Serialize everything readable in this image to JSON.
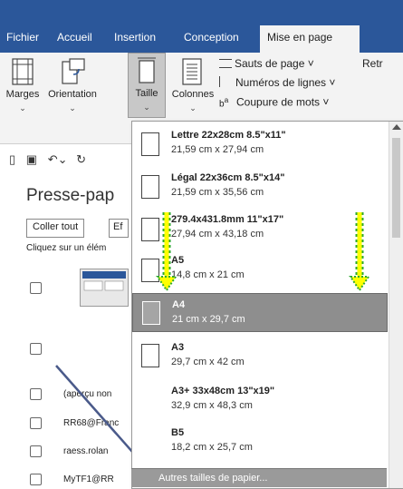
{
  "tabs": [
    "Fichier",
    "Accueil",
    "Insertion",
    "Conception",
    "Mise en page"
  ],
  "active_tab": "Mise en page",
  "ribbon": {
    "marges": "Marges",
    "orientation": "Orientation",
    "taille": "Taille",
    "colonnes": "Colonnes",
    "sauts": "Sauts de page ˅",
    "numeros": "Numéros de lignes ˅",
    "coupure": "Coupure de mots ˅",
    "retrait": "Retr"
  },
  "pane": {
    "title": "Presse-pap",
    "coller_tout": "Coller tout",
    "effacer_partial": "Ef",
    "hint": "Cliquez sur un élém",
    "clips": [
      "(aperçu non",
      "RR68@Franc",
      "raess.rolan",
      "MyTF1@RR"
    ]
  },
  "paper_sizes": [
    {
      "name": "Lettre 22x28cm 8.5\"x11\"",
      "dim": "21,59 cm x 27,94 cm"
    },
    {
      "name": "Légal 22x36cm 8.5\"x14\"",
      "dim": "21,59 cm x 35,56 cm"
    },
    {
      "name": "279.4x431.8mm 11\"x17\"",
      "dim": "27,94 cm x 43,18 cm"
    },
    {
      "name": "A5",
      "dim": "14,8 cm x 21 cm"
    },
    {
      "name": "A4",
      "dim": "21 cm x 29,7 cm"
    },
    {
      "name": "A3",
      "dim": "29,7 cm x 42 cm"
    },
    {
      "name": "A3+ 33x48cm 13\"x19\"",
      "dim": "32,9 cm x 48,3 cm"
    },
    {
      "name": "B5",
      "dim": "18,2 cm x 25,7 cm"
    }
  ],
  "selected_size": "A4",
  "more_sizes": "Autres tailles de papier...",
  "colors": {
    "ribbon_blue": "#2b579a",
    "selected_gray": "#8e8e8e",
    "annotation_yellow": "#ffff00",
    "annotation_green": "#2eaa2e",
    "arrow_blue": "#4a5a8a"
  },
  "icons": [
    "marges-icon",
    "orientation-icon",
    "taille-icon",
    "colonnes-icon",
    "page-break-icon",
    "line-numbers-icon",
    "hyphenation-icon",
    "new-doc-icon",
    "save-icon",
    "undo-icon",
    "clipboard-icon"
  ]
}
